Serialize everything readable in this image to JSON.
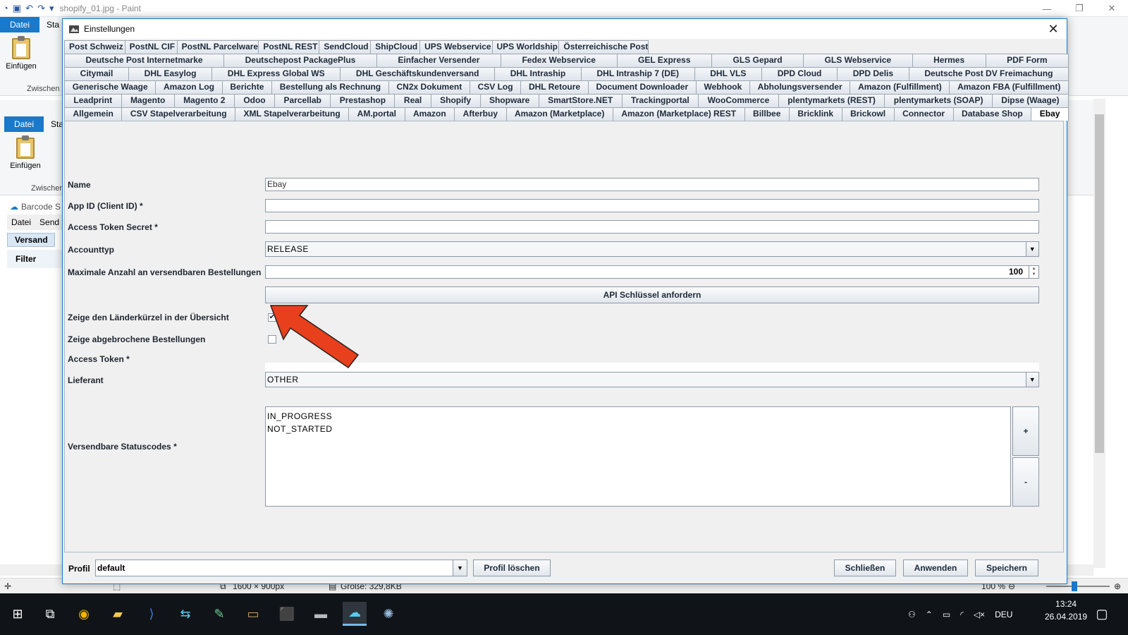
{
  "paint": {
    "title": "shopify_01.jpg - Paint",
    "tab_file": "Datei",
    "tab_start": "Sta",
    "tab_start_2": "Sta",
    "paste": "Einfügen",
    "clipboard": "Zwischen",
    "clipboard_2": "Zwischen",
    "status_dims": "1600 × 900px",
    "status_size": "Größe: 329,8KB",
    "zoom": "100 %"
  },
  "bg_app": {
    "title": "Barcode S",
    "menu_file": "Datei",
    "menu_send": "Send",
    "tab_versand": "Versand",
    "filter": "Filter"
  },
  "dialog": {
    "title": "Einstellungen",
    "tab_rows": [
      [
        "Post Schweiz",
        "PostNL CIF",
        "PostNL Parcelware",
        "PostNL REST",
        "SendCloud",
        "ShipCloud",
        "UPS Webservice",
        "UPS Worldship",
        "Österreichische Post"
      ],
      [
        "Deutsche Post Internetmarke",
        "Deutschepost PackagePlus",
        "Einfacher Versender",
        "Fedex Webservice",
        "GEL Express",
        "GLS Gepard",
        "GLS Webservice",
        "Hermes",
        "PDF Form"
      ],
      [
        "Citymail",
        "DHL Easylog",
        "DHL Express Global WS",
        "DHL Geschäftskundenversand",
        "DHL Intraship",
        "DHL Intraship 7 (DE)",
        "DHL VLS",
        "DPD Cloud",
        "DPD Delis",
        "Deutsche Post DV Freimachung"
      ],
      [
        "Generische Waage",
        "Amazon Log",
        "Berichte",
        "Bestellung als Rechnung",
        "CN2x Dokument",
        "CSV Log",
        "DHL Retoure",
        "Document Downloader",
        "Webhook",
        "Abholungsversender",
        "Amazon (Fulfillment)",
        "Amazon FBA (Fulfillment)"
      ],
      [
        "Leadprint",
        "Magento",
        "Magento 2",
        "Odoo",
        "Parcellab",
        "Prestashop",
        "Real",
        "Shopify",
        "Shopware",
        "SmartStore.NET",
        "Trackingportal",
        "WooCommerce",
        "plentymarkets (REST)",
        "plentymarkets (SOAP)",
        "Dipse (Waage)"
      ],
      [
        "Allgemein",
        "CSV Stapelverarbeitung",
        "XML Stapelverarbeitung",
        "AM.portal",
        "Amazon",
        "Afterbuy",
        "Amazon (Marketplace)",
        "Amazon (Marketplace) REST",
        "Billbee",
        "Bricklink",
        "Brickowl",
        "Connector",
        "Database Shop",
        "Ebay"
      ]
    ],
    "selected_tab": "Ebay",
    "form": {
      "name_label": "Name",
      "name_value": "Ebay",
      "appid_label": "App ID (Client ID) *",
      "appid_value": "",
      "secret_label": "Access Token Secret *",
      "secret_value": "",
      "accounttype_label": "Accounttyp",
      "accounttype_value": "RELEASE",
      "maxorders_label": "Maximale Anzahl an versendbaren Bestellungen",
      "maxorders_value": "100",
      "api_button": "API Schlüssel anfordern",
      "country_label": "Zeige den Länderkürzel in der Übersicht",
      "country_checked": true,
      "cancelled_label": "Zeige abgebrochene Bestellungen",
      "cancelled_checked": false,
      "token_label": "Access Token *",
      "supplier_label": "Lieferant",
      "supplier_value": "OTHER",
      "status_label": "Versendbare Statuscodes *",
      "status_codes": [
        "IN_PROGRESS",
        "NOT_STARTED"
      ],
      "add_button": "+",
      "remove_button": "-"
    },
    "footer": {
      "profil_label": "Profil",
      "profil_value": "default",
      "delete_button": "Profil löschen",
      "close_button": "Schließen",
      "apply_button": "Anwenden",
      "save_button": "Speichern"
    }
  },
  "taskbar": {
    "lang": "DEU",
    "time": "13:24",
    "date": "26.04.2019"
  },
  "colors": {
    "accent": "#1979ca",
    "arrow": "#e8401c"
  }
}
